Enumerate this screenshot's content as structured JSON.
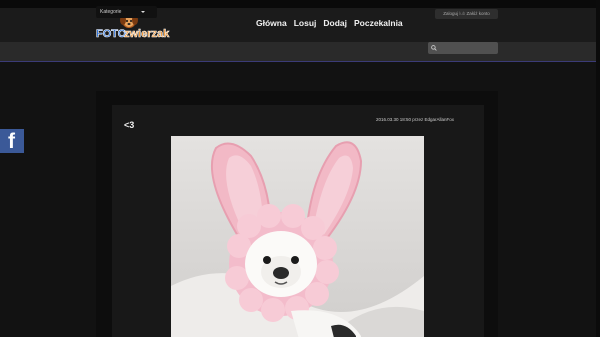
{
  "header": {
    "logo": {
      "part1": "FOTO",
      "part2": "zwierzak"
    },
    "nav": [
      {
        "label": "Główna"
      },
      {
        "label": "Losuj"
      },
      {
        "label": "Dodaj"
      },
      {
        "label": "Poczekalnia"
      }
    ],
    "auth": {
      "login": "Zaloguj",
      "separator": "lub",
      "register": "Załóż konto"
    }
  },
  "subbar": {
    "category_label": "Kategorie",
    "search_placeholder": ""
  },
  "post": {
    "title": "<3",
    "meta": "2016.03.30 18:50 przez EdgarAllanFox"
  },
  "social": {
    "facebook_glyph": "f"
  },
  "colors": {
    "background": "#121212",
    "facebook": "#3b5998",
    "logo_blue": "#2a6fd6",
    "logo_orange": "#f08a1c"
  }
}
